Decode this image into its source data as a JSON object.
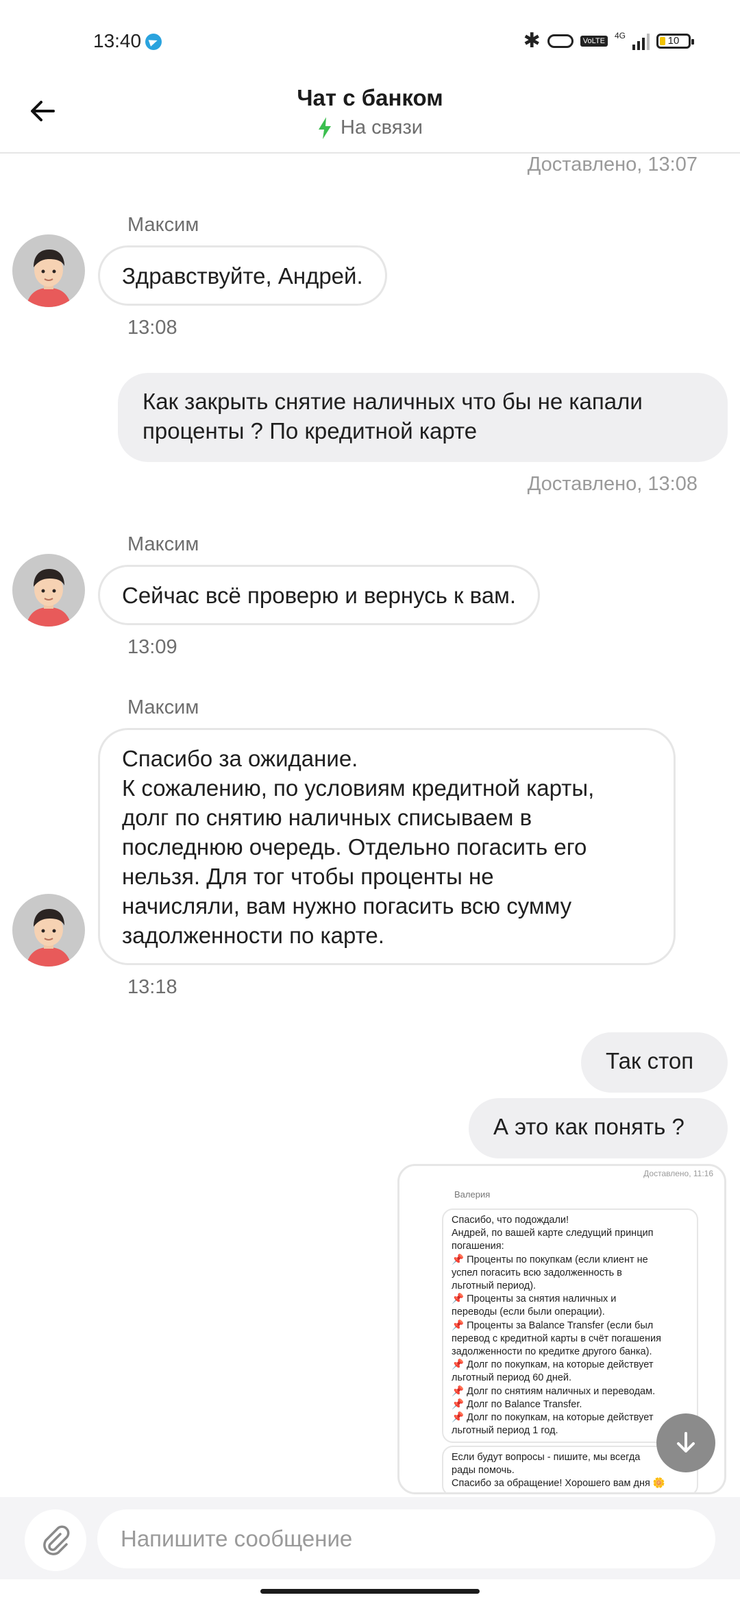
{
  "status_bar": {
    "time": "13:40",
    "network": "4G",
    "volte": "VoLTE",
    "battery": "10"
  },
  "header": {
    "title": "Чат с банком",
    "status": "На связи"
  },
  "messages": {
    "delivered_1": "Доставлено, 13:07",
    "m1_sender": "Максим",
    "m1_text": "Здравствуйте, Андрей.",
    "m1_time": "13:08",
    "out1_text": "Как закрыть снятие наличных что бы не капали\nпроценты ? По кредитной карте",
    "delivered_2": "Доставлено, 13:08",
    "m2_sender": "Максим",
    "m2_text": "Сейчас всё проверю и вернусь к вам.",
    "m2_time": "13:09",
    "m3_sender": "Максим",
    "m3_text": "Спасибо за ожидание.\nК сожалению, по условиям кредитной карты,\nдолг по снятию наличных списываем в\nпоследнюю очередь. Отдельно погасить его\nнельзя. Для тог чтобы проценты не\nначисляли, вам нужно погасить всю сумму\nзадолженности по карте.",
    "m3_time": "13:18",
    "out2_text": "Так стоп",
    "out3_text": "А это как понять ?"
  },
  "screenshot_message": {
    "delivered": "Доставлено, 11:16",
    "sender": "Валерия",
    "text": "Спасибо, что подождали!\nАндрей, по вашей карте следущий принцип\nпогашения:\n📌 Проценты по покупкам (если клиент не\nуспел погасить всю задолженность в\nльготный период).\n📌 Проценты за снятия наличных и\nпереводы (если были операции).\n📌 Проценты за Balance Transfer (если был\nперевод с кредитной карты в счёт погашения\nзадолженности по кредитке другого банка).\n📌 Долг по покупкам, на которые действует\nльготный период 60 дней.\n📌 Долг по снятиям наличных и переводам.\n📌 Долг по Balance Transfer.\n📌 Долг по покупкам, на которые действует\nльготный период 1 год.",
    "text2": "Если будут вопросы - пишите, мы всегда\nрады помочь.\nСпасибо за обращение! Хорошего вам дня 🌼"
  },
  "composer": {
    "placeholder": "Напишите сообщение"
  },
  "colors": {
    "accent_green": "#3bbf4f",
    "bubble_out": "#efeff1",
    "bubble_border": "#e6e6e6"
  }
}
